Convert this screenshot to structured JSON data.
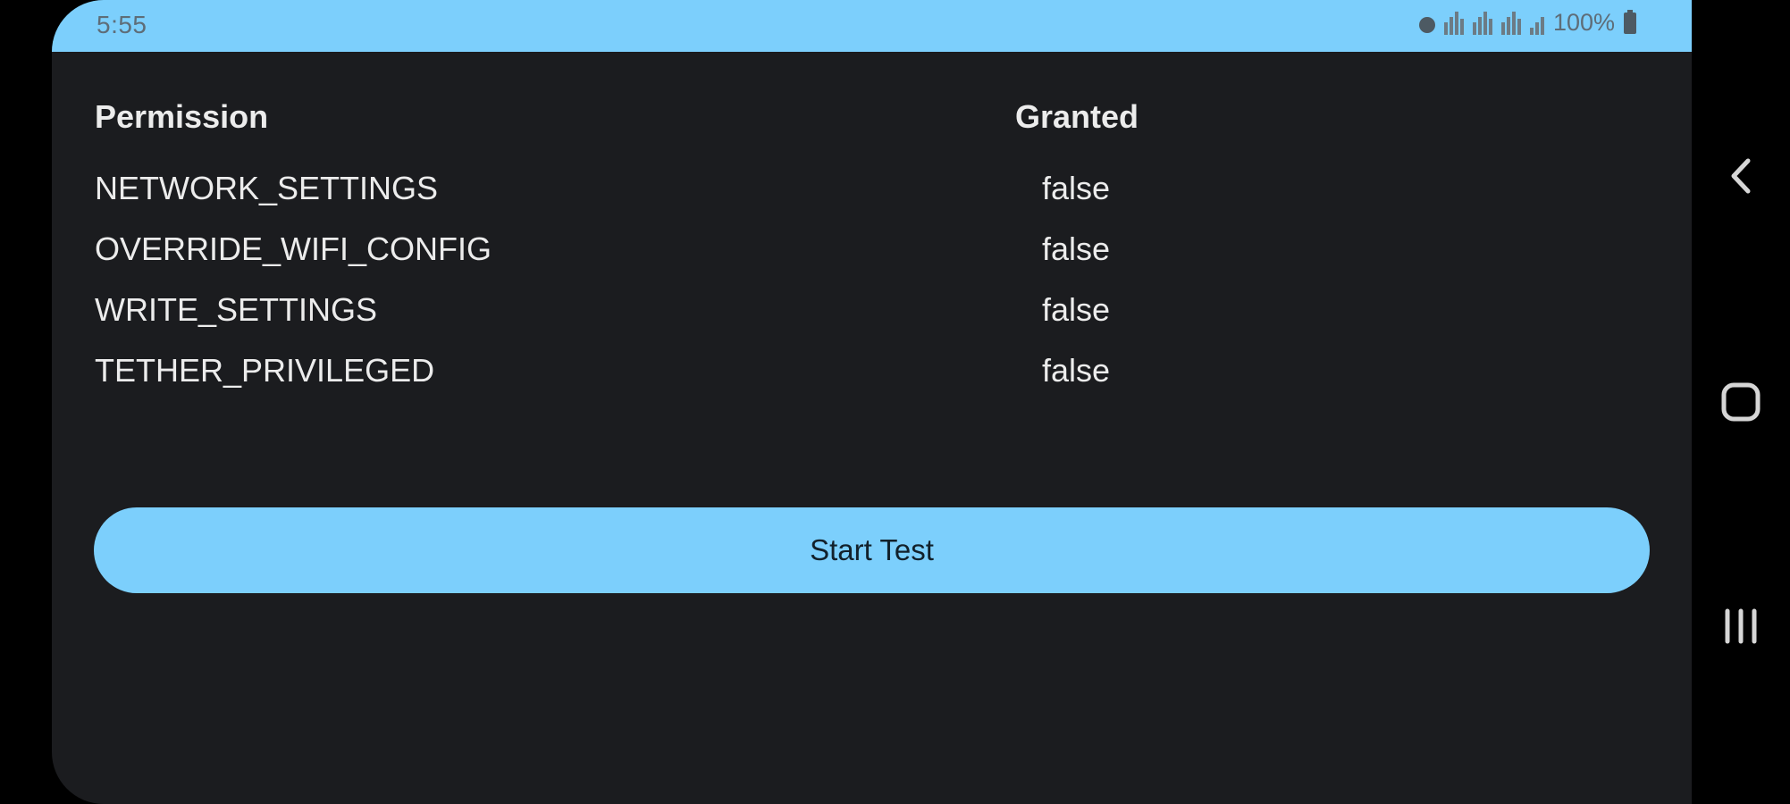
{
  "status_bar": {
    "time": "5:55",
    "battery": "100%",
    "icons": [
      "alarm-icon",
      "network-icon",
      "network-icon",
      "network-icon",
      "signal-icon",
      "battery-icon"
    ]
  },
  "table": {
    "headers": {
      "permission": "Permission",
      "granted": "Granted"
    },
    "rows": [
      {
        "name": "NETWORK_SETTINGS",
        "granted": "false"
      },
      {
        "name": "OVERRIDE_WIFI_CONFIG",
        "granted": "false"
      },
      {
        "name": "WRITE_SETTINGS",
        "granted": "false"
      },
      {
        "name": "TETHER_PRIVILEGED",
        "granted": "false"
      }
    ]
  },
  "actions": {
    "start_test_label": "Start Test"
  },
  "nav": {
    "icons": [
      "back-icon",
      "home-icon",
      "recent-apps-icon"
    ]
  },
  "colors": {
    "accent": "#7ccffc",
    "background": "#1b1c1f",
    "text": "#ececec"
  }
}
